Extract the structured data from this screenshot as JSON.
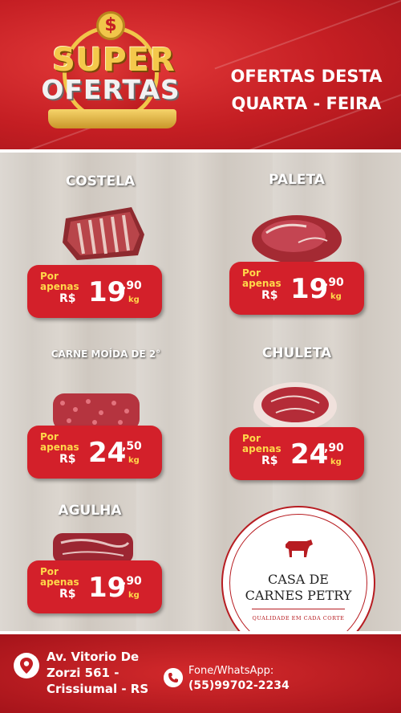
{
  "header": {
    "badge_symbol": "$",
    "badge_line1": "SUPER",
    "badge_line2": "OFERTAS",
    "title_line1": "OFERTAS DESTA",
    "title_line2": "QUARTA - FEIRA"
  },
  "price_label": {
    "por": "Por",
    "apenas": "apenas",
    "currency": "R$",
    "unit": "kg"
  },
  "products": [
    {
      "name": "COSTELA",
      "integer": "19",
      "decimal": ",90"
    },
    {
      "name": "PALETA",
      "integer": "19",
      "decimal": ",90"
    },
    {
      "name": "CARNE MOÍDA DE 2°",
      "integer": "24",
      "decimal": ",50"
    },
    {
      "name": "CHULETA",
      "integer": "24",
      "decimal": ",90"
    },
    {
      "name": "AGULHA",
      "integer": "19",
      "decimal": ",90"
    }
  ],
  "logo": {
    "line1": "CASA DE",
    "line2": "CARNES PETRY",
    "tagline": "QUALIDADE EM CADA CORTE"
  },
  "footer": {
    "address_line1": "Av. Vitorio De",
    "address_line2": "Zorzi 561 -",
    "address_line3": "Crissiumal - RS",
    "phone_label": "Fone/WhatsApp:",
    "phone_number": "(55)99702-2234"
  },
  "colors": {
    "brand_red": "#d3202a",
    "accent_yellow": "#ffd84a",
    "gold": "#f1c64a"
  }
}
